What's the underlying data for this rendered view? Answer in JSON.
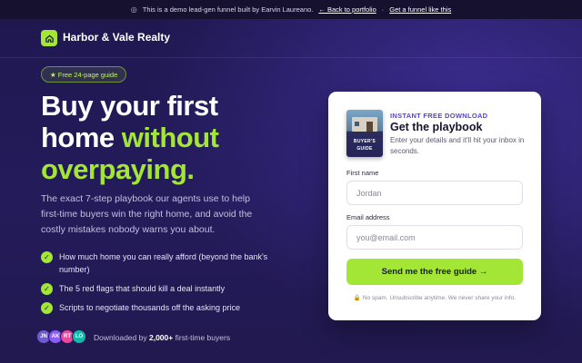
{
  "banner": {
    "icon": "demo-icon",
    "text": "This is a demo lead-gen funnel built by Earvin Laureano.",
    "back_link": "← Back to portfolio",
    "cta_link": "Get a funnel like this"
  },
  "nav": {
    "logo_icon": "home-icon",
    "brand": "Harbor & Vale Realty"
  },
  "hero": {
    "badge": "★ Free 24-page guide",
    "headline_line1": "Buy your first",
    "headline_line2_plain": "home ",
    "headline_line2_accent": "without",
    "headline_line3_accent": "overpaying.",
    "subtext": "The exact 7-step playbook our agents use to help first-time buyers win the right home, and avoid the costly mistakes nobody warns you about.",
    "checklist": [
      "How much home you can really afford (beyond the bank's number)",
      "The 5 red flags that should kill a deal instantly",
      "Scripts to negotiate thousands off the asking price"
    ],
    "avatars": [
      {
        "initials": "JN",
        "color": "#6d5bd0"
      },
      {
        "initials": "AK",
        "color": "#8b5cf6"
      },
      {
        "initials": "RT",
        "color": "#ec4899"
      },
      {
        "initials": "LO",
        "color": "#14b8a6"
      }
    ],
    "social_prefix": "Downloaded by",
    "social_count": "2,000+",
    "social_suffix": "first-time buyers"
  },
  "form": {
    "book_title": "BUYER'S GUIDE",
    "eyebrow": "INSTANT FREE DOWNLOAD",
    "title": "Get the playbook",
    "description": "Enter your details and it'll hit your inbox in seconds.",
    "first_name_label": "First name",
    "first_name_placeholder": "Jordan",
    "email_label": "Email address",
    "email_placeholder": "you@email.com",
    "submit_label": "Send me the free guide →",
    "fineprint": "🔒 No spam. Unsubscribe anytime. We never share your info."
  },
  "colors": {
    "accent": "#a3e635",
    "background": "#221a55",
    "eyebrow": "#5b3fd6"
  }
}
